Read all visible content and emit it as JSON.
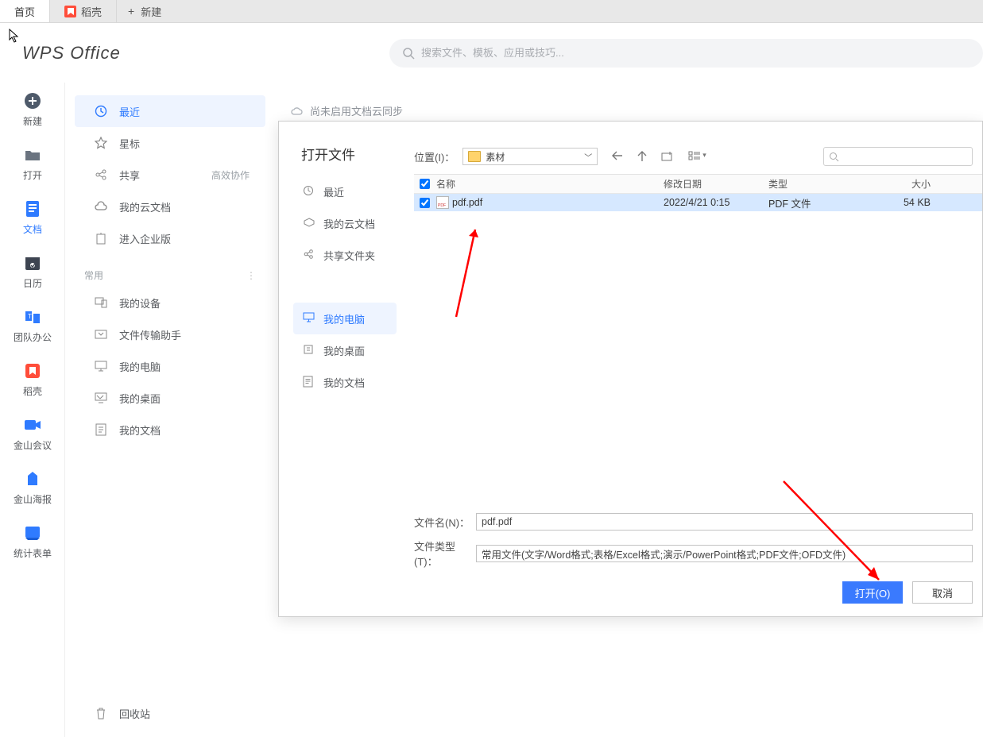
{
  "tabs": {
    "home": "首页",
    "docer": "稻壳",
    "new_tab": "新建"
  },
  "logo": "WPS Office",
  "search_placeholder": "搜索文件、模板、应用或技巧...",
  "leftnav": {
    "new": "新建",
    "open": "打开",
    "docs": "文档",
    "calendar": "日历",
    "team": "团队办公",
    "docer": "稻壳",
    "meeting": "金山会议",
    "poster": "金山海报",
    "form": "统计表单"
  },
  "sidecol": {
    "recent": "最近",
    "star": "星标",
    "share": "共享",
    "share_badge": "高效协作",
    "cloud": "我的云文档",
    "enterprise": "进入企业版",
    "section_common": "常用",
    "device": "我的设备",
    "transfer": "文件传输助手",
    "mypc": "我的电脑",
    "desktop": "我的桌面",
    "mydocs": "我的文档",
    "recycle": "回收站"
  },
  "sync_notice": "尚未启用文档云同步",
  "dialog": {
    "title": "打开文件",
    "nav": {
      "recent": "最近",
      "cloud": "我的云文档",
      "shared": "共享文件夹",
      "mypc": "我的电脑",
      "desktop": "我的桌面",
      "mydocs": "我的文档"
    },
    "location_label": "位置(I)：",
    "location_value": "素材",
    "columns": {
      "name": "名称",
      "date": "修改日期",
      "type": "类型",
      "size": "大小"
    },
    "files": [
      {
        "name": "pdf.pdf",
        "date": "2022/4/21 0:15",
        "type": "PDF 文件",
        "size": "54 KB"
      }
    ],
    "filename_label": "文件名(N)：",
    "filename_value": "pdf.pdf",
    "filetype_label": "文件类型(T)：",
    "filetype_value": "常用文件(文字/Word格式;表格/Excel格式;演示/PowerPoint格式;PDF文件;OFD文件)",
    "open_btn": "打开(O)",
    "cancel_btn": "取消"
  }
}
